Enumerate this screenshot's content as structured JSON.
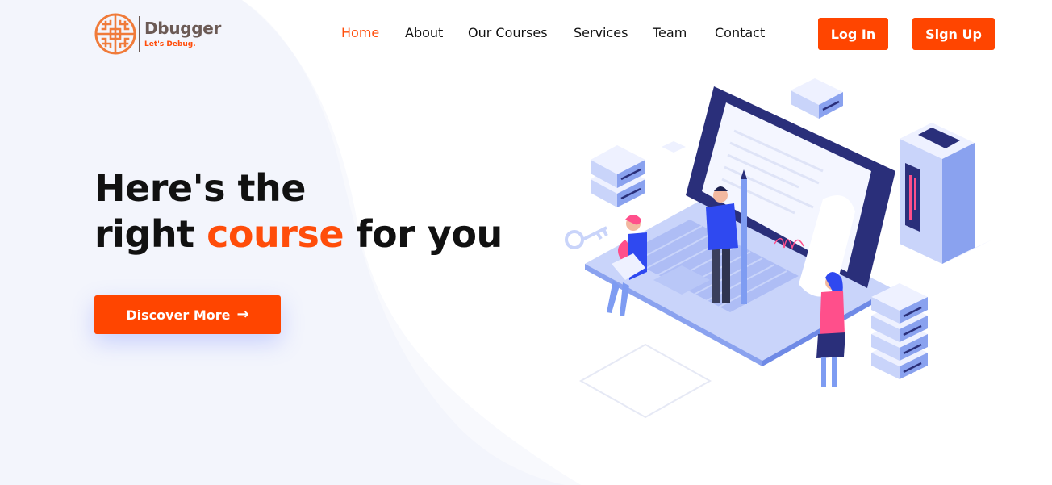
{
  "brand": {
    "name": "Dbugger",
    "tagline": "Let's Debug."
  },
  "nav": {
    "items": [
      {
        "label": "Home",
        "active": true
      },
      {
        "label": "About",
        "active": false
      },
      {
        "label": "Our Courses",
        "active": false
      },
      {
        "label": "Services",
        "active": false
      },
      {
        "label": "Team",
        "active": false
      },
      {
        "label": "Contact",
        "active": false
      }
    ]
  },
  "auth": {
    "login_label": "Log In",
    "signup_label": "Sign Up"
  },
  "hero": {
    "line1": "Here's the",
    "line2_pre": "right ",
    "line2_accent": "course",
    "line2_post": " for you",
    "cta_label": "Discover More",
    "cta_icon": "arrow-right-icon"
  },
  "colors": {
    "accent": "#ff4500",
    "brand_text": "#6b5a55",
    "illustration_navy": "#2a2f7a",
    "illustration_blue": "#7e9cf2",
    "illustration_pink": "#ff4f8b"
  }
}
